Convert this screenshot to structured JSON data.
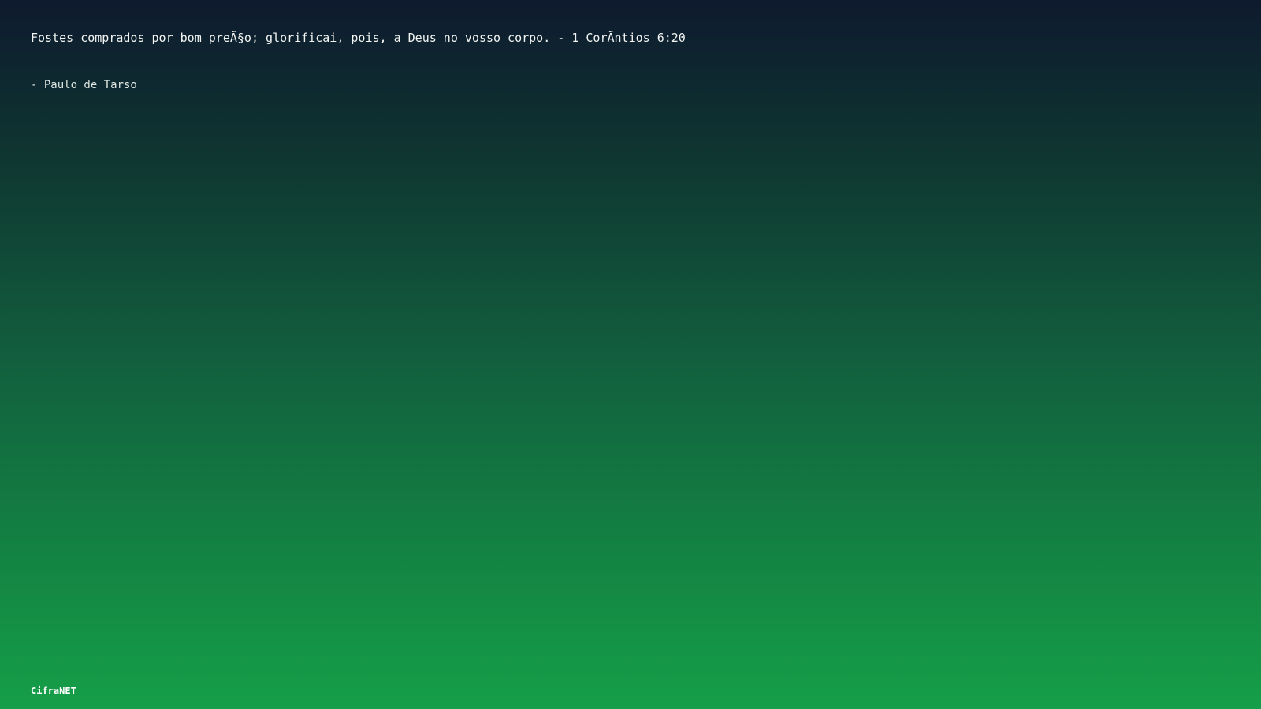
{
  "quote": {
    "text": "Fostes comprados por bom preÃ§o; glorificai, pois, a Deus no vosso corpo. - 1 CorÃ­ntios 6:20",
    "author": "- Paulo de Tarso"
  },
  "footer": {
    "brand": "CifraNET"
  },
  "colors": {
    "gradient_top": "#0e1a2e",
    "gradient_bottom": "#159f48",
    "text": "#ffffff"
  }
}
